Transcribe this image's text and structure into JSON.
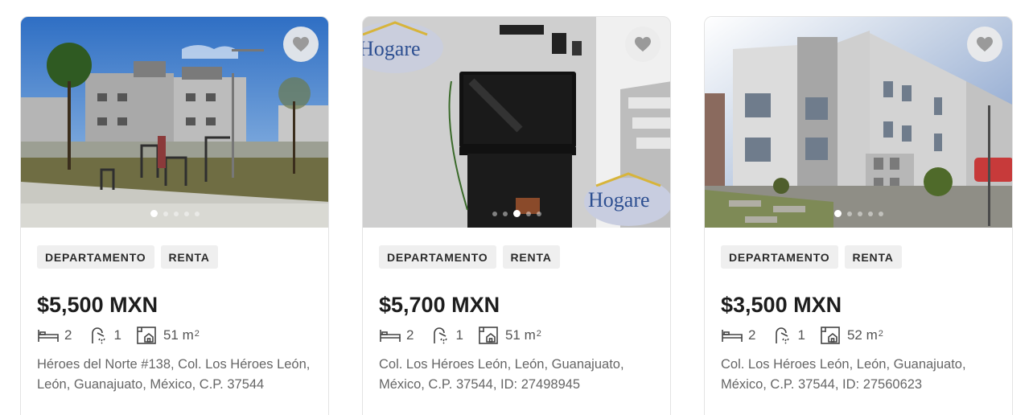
{
  "listings": [
    {
      "badges": [
        "DEPARTAMENTO",
        "RENTA"
      ],
      "price": "$5,500 MXN",
      "beds": "2",
      "baths": "1",
      "area": "51 m",
      "area_unit_sup": "2",
      "address": "Héroes del Norte #138, Col. Los Héroes León, León, Guanajuato, México, C.P. 37544",
      "photo_dots": 5,
      "active_dot": 0,
      "favorite_icon": "heart-icon"
    },
    {
      "badges": [
        "DEPARTAMENTO",
        "RENTA"
      ],
      "price": "$5,700 MXN",
      "beds": "2",
      "baths": "1",
      "area": "51 m",
      "area_unit_sup": "2",
      "address": "Col. Los Héroes León, León, Guanajuato, México, C.P. 37544, ID: 27498945",
      "watermark": "Hogare",
      "photo_dots": 5,
      "active_dot": 2,
      "favorite_icon": "heart-icon"
    },
    {
      "badges": [
        "DEPARTAMENTO",
        "RENTA"
      ],
      "price": "$3,500 MXN",
      "beds": "2",
      "baths": "1",
      "area": "52 m",
      "area_unit_sup": "2",
      "address": "Col. Los Héroes León, León, Guanajuato, México, C.P. 37544, ID: 27560623",
      "photo_dots": 5,
      "active_dot": 0,
      "favorite_icon": "heart-icon"
    }
  ],
  "colors": {
    "badge_bg": "#efefef",
    "price": "#1d1d1d",
    "muted_text": "#666666",
    "fav_button_bg": "#ebebeb",
    "heart": "#9a9a9a"
  }
}
